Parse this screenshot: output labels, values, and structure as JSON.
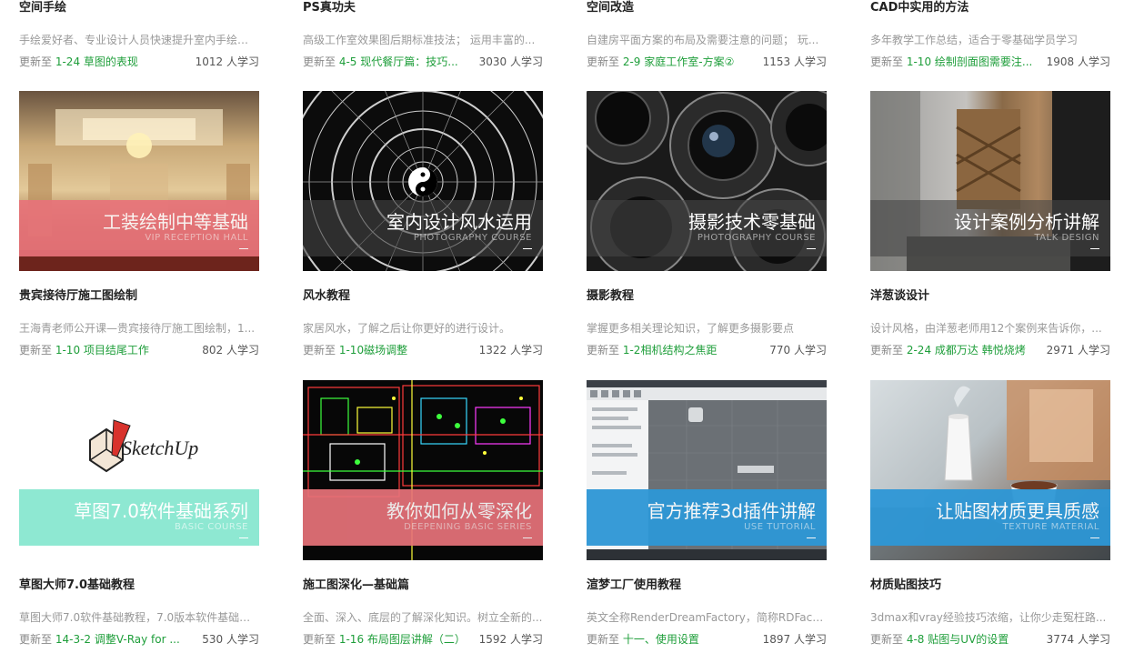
{
  "top_row": [
    {
      "title": "空间手绘",
      "desc": "手绘爱好者、专业设计人员快速提升室内手绘表现...",
      "update_prefix": "更新至",
      "lesson": "1-24 草图的表现",
      "count": "1012 人学习"
    },
    {
      "title": "PS真功夫",
      "desc": "高级工作室效果图后期标准技法； 运用丰富的...",
      "update_prefix": "更新至",
      "lesson": "4-5 现代餐厅篇：技巧...",
      "count": "3030 人学习"
    },
    {
      "title": "空间改造",
      "desc": "自建房平面方案的布局及需要注意的问题； 玩...",
      "update_prefix": "更新至",
      "lesson": "2-9 家庭工作室-方案②",
      "count": "1153 人学习"
    },
    {
      "title": "CAD中实用的方法",
      "desc": "多年教学工作总结，适合于零基础学员学习",
      "update_prefix": "更新至",
      "lesson": "1-10 绘制剖面图需要注...",
      "count": "1908 人学习"
    }
  ],
  "courses": [
    {
      "banner_title": "工装绘制中等基础",
      "banner_sub": "VIP RECEPTION HALL",
      "banner_color": "#e8737a",
      "title": "贵宾接待厅施工图绘制",
      "desc": "王海青老师公开课—贵宾接待厅施工图绘制，1...",
      "update_prefix": "更新至",
      "lesson": "1-10 项目结尾工作",
      "count": "802 人学习"
    },
    {
      "banner_title": "室内设计风水运用",
      "banner_sub": "PHOTOGRAPHY COURSE",
      "banner_color": "#555555",
      "title": "风水教程",
      "desc": "家居风水，了解之后让你更好的进行设计。",
      "update_prefix": "更新至",
      "lesson": "1-10磁场调整",
      "count": "1322 人学习"
    },
    {
      "banner_title": "摄影技术零基础",
      "banner_sub": "PHOTOGRAPHY COURSE",
      "banner_color": "#555555",
      "title": "摄影教程",
      "desc": "掌握更多相关理论知识，了解更多摄影要点",
      "update_prefix": "更新至",
      "lesson": "1-2相机结构之焦距",
      "count": "770 人学习"
    },
    {
      "banner_title": "设计案例分析讲解",
      "banner_sub": "TALK DESIGN",
      "banner_color": "#555555",
      "title": "洋葱谈设计",
      "desc": "设计风格，由洋葱老师用12个案例来告诉你，...",
      "update_prefix": "更新至",
      "lesson": "2-24 成都万达 韩悦烧烤",
      "count": "2971 人学习"
    },
    {
      "banner_title": "草图7.0软件基础系列",
      "banner_sub": "BASIC COURSE",
      "banner_color": "#8ee8d2",
      "title": "草图大师7.0基础教程",
      "desc": "草图大师7.0软件基础教程，7.0版本软件基础教...",
      "update_prefix": "更新至",
      "lesson": "14-3-2 调整V-Ray for ...",
      "count": "530 人学习"
    },
    {
      "banner_title": "教你如何从零深化",
      "banner_sub": "DEEPENING BASIC SERIES",
      "banner_color": "#e8737a",
      "title": "施工图深化—基础篇",
      "desc": "全面、深入、底层的了解深化知识。树立全新的...",
      "update_prefix": "更新至",
      "lesson": "1-16 布局图层讲解（二）",
      "count": "1592 人学习"
    },
    {
      "banner_title": "官方推荐3d插件讲解",
      "banner_sub": "USE TUTORIAL",
      "banner_color": "#2d97d6",
      "title": "渲梦工厂使用教程",
      "desc": "英文全称RenderDreamFactory，简称RDFact...",
      "update_prefix": "更新至",
      "lesson": "十一、使用设置",
      "count": "1897 人学习"
    },
    {
      "banner_title": "让贴图材质更具质感",
      "banner_sub": "TEXTURE MATERIAL",
      "banner_color": "#2d97d6",
      "title": "材质贴图技巧",
      "desc": "3dmax和vray经验技巧浓缩，让你少走冤枉路...",
      "update_prefix": "更新至",
      "lesson": "4-8 贴图与UV的设置",
      "count": "3774 人学习"
    }
  ],
  "logo_text": "SketchUp"
}
